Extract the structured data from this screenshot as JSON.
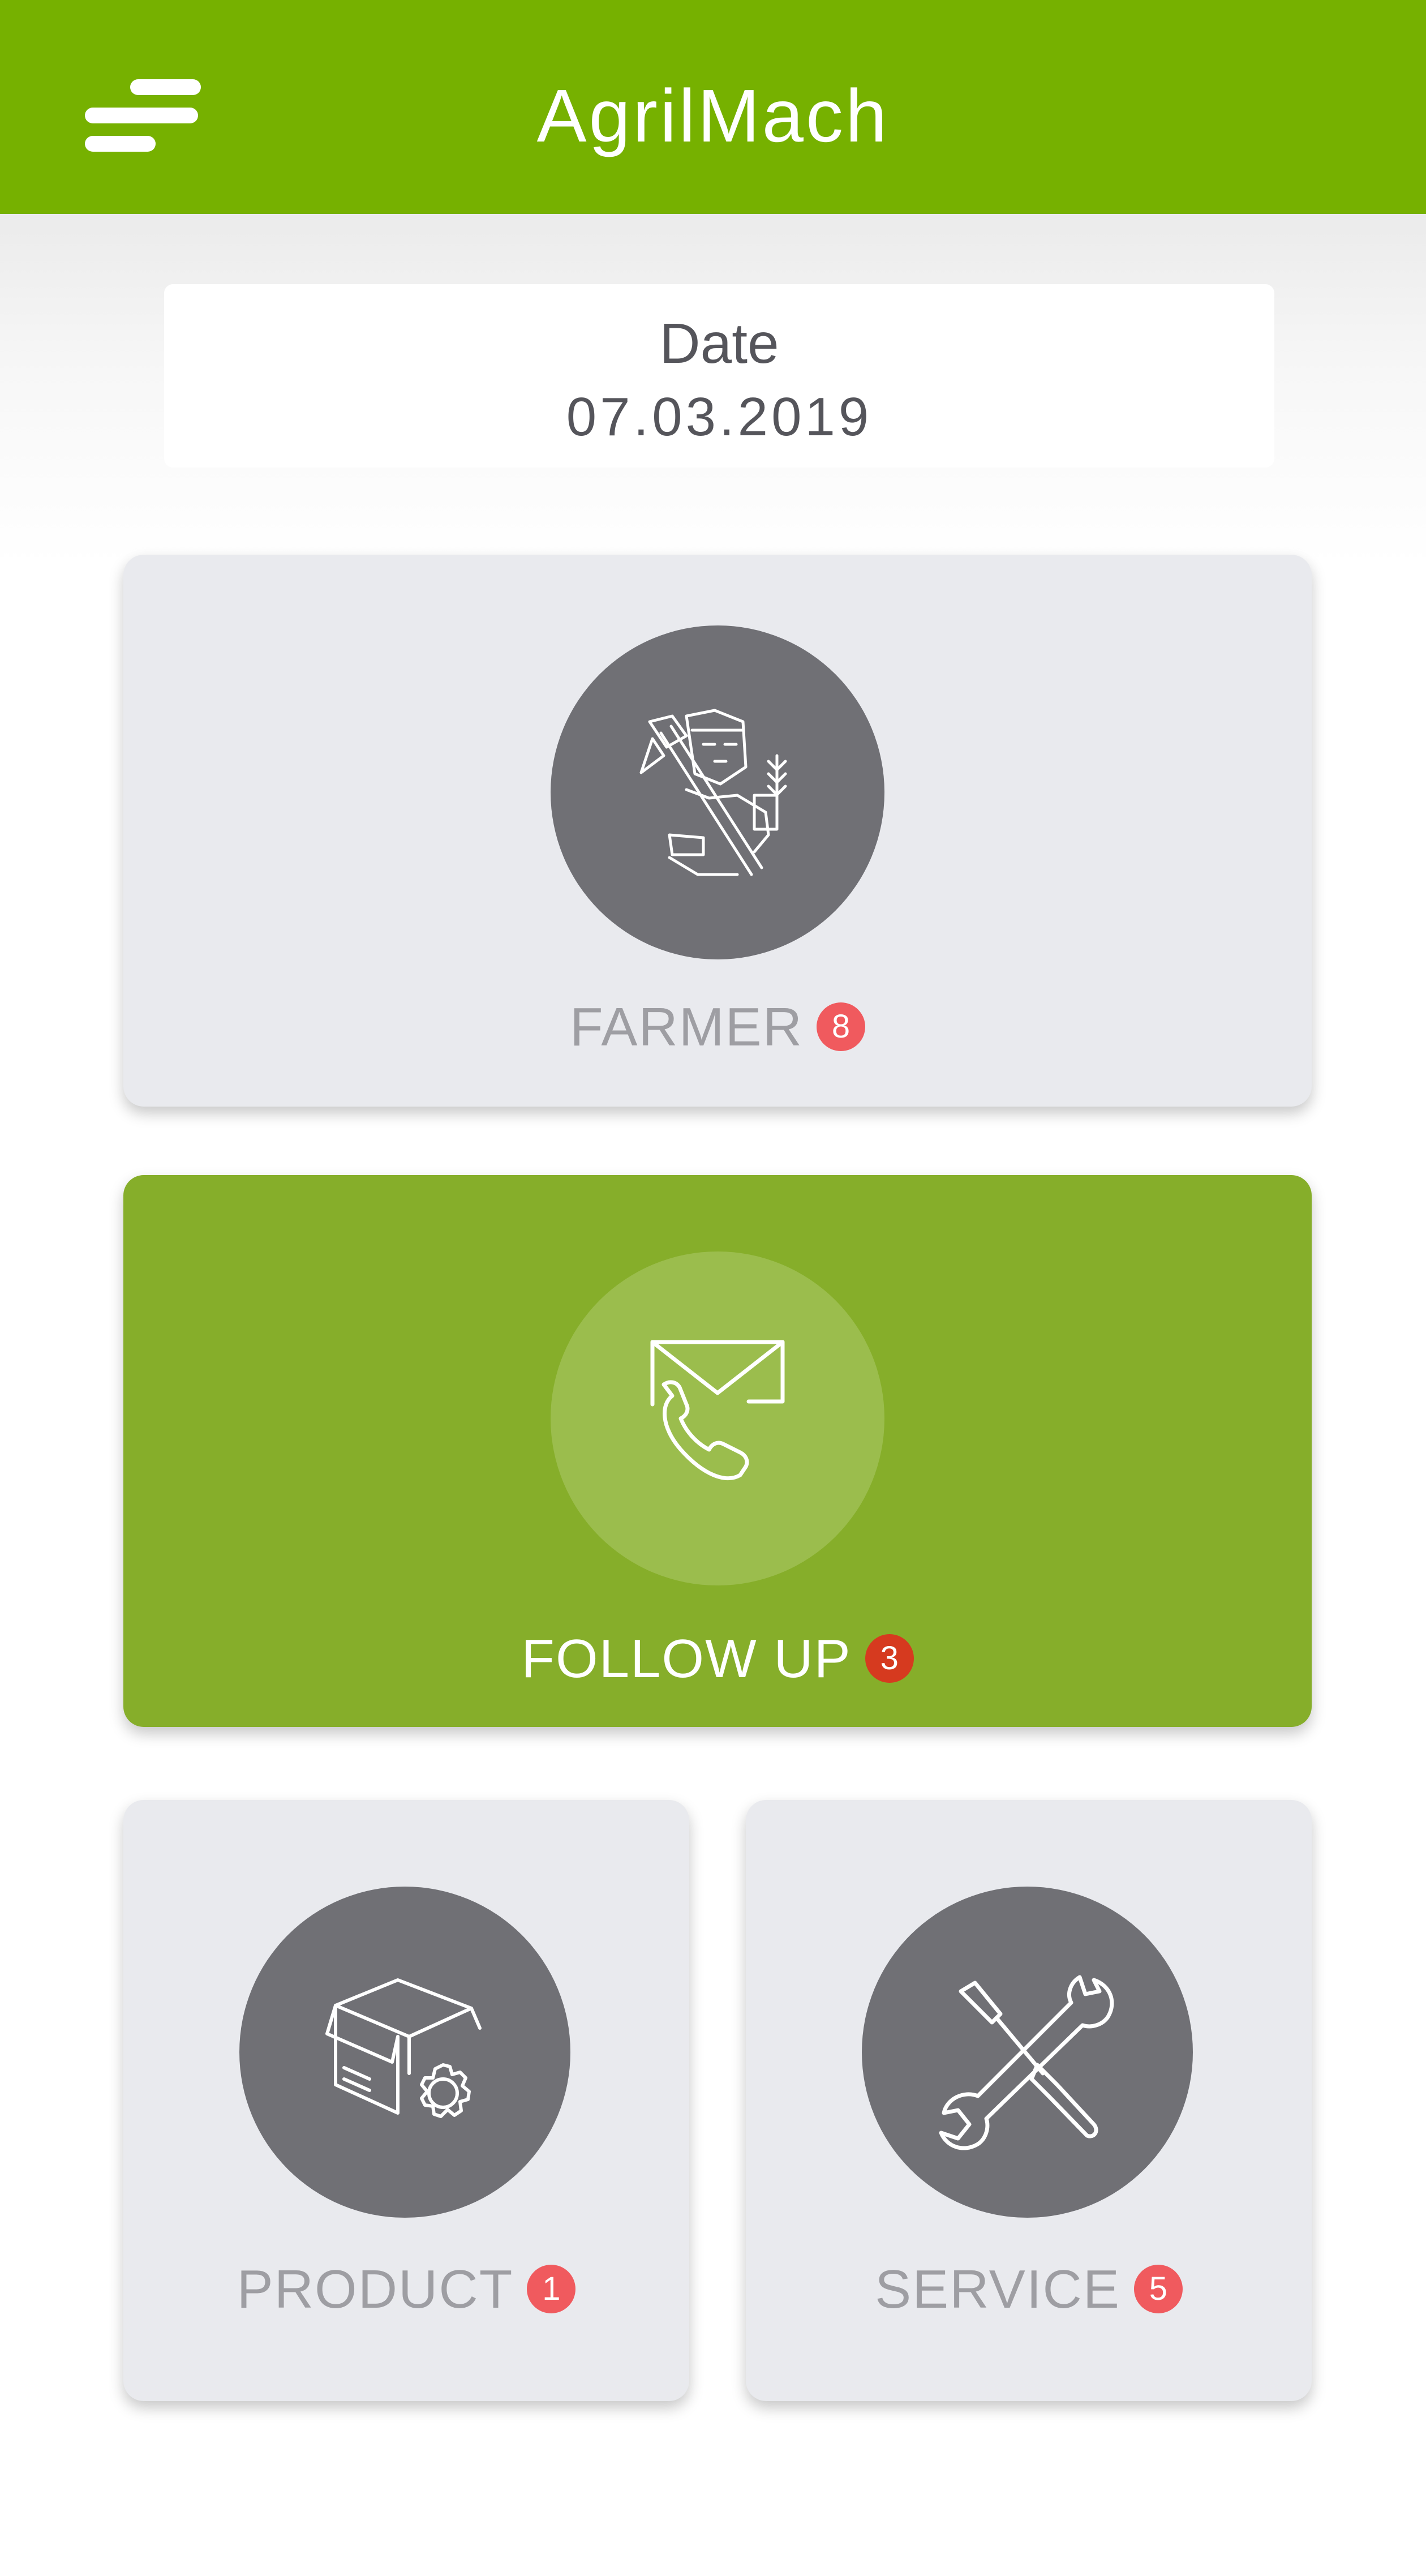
{
  "header": {
    "title": "AgrilMach",
    "menu_icon": "menu-lines-icon",
    "background": "#76b100"
  },
  "date": {
    "label": "Date",
    "value": "07.03.2019"
  },
  "tiles": {
    "farmer": {
      "label": "FARMER",
      "badge": "8",
      "icon": "farmer-icon"
    },
    "follow_up": {
      "label": "FOLLOW UP",
      "badge": "3",
      "icon": "mail-phone-icon",
      "active": true
    },
    "product": {
      "label": "PRODUCT",
      "badge": "1",
      "icon": "box-gear-icon"
    },
    "service": {
      "label": "SERVICE",
      "badge": "5",
      "icon": "wrench-screwdriver-icon"
    }
  },
  "colors": {
    "tile_bg": "#e9eaee",
    "active_tile_bg": "#86ae2a",
    "icon_circle": "#707075",
    "badge": "#f05a5e",
    "active_badge": "#d63a1f"
  }
}
